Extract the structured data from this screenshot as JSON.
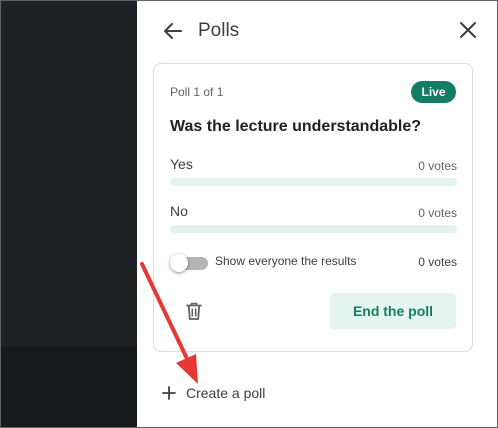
{
  "panel": {
    "title": "Polls",
    "back_icon": "arrow-back-icon",
    "close_icon": "close-icon"
  },
  "poll": {
    "counter": "Poll 1 of 1",
    "status_badge": "Live",
    "question": "Was the lecture understandable?",
    "options": [
      {
        "label": "Yes",
        "votes": "0 votes",
        "fraction": 0
      },
      {
        "label": "No",
        "votes": "0 votes",
        "fraction": 0
      }
    ],
    "show_results": {
      "label": "Show everyone the results",
      "votes": "0 votes",
      "enabled": false
    },
    "delete_icon": "trash-icon",
    "end_button_label": "End the poll"
  },
  "create_poll": {
    "label": "Create a poll",
    "icon": "plus-icon"
  },
  "colors": {
    "accent": "#137e63",
    "accent_light": "#e5f4ef",
    "bar_track": "#e1f3ee",
    "left_dark": "#202124",
    "annotation_arrow": "#e53935"
  }
}
